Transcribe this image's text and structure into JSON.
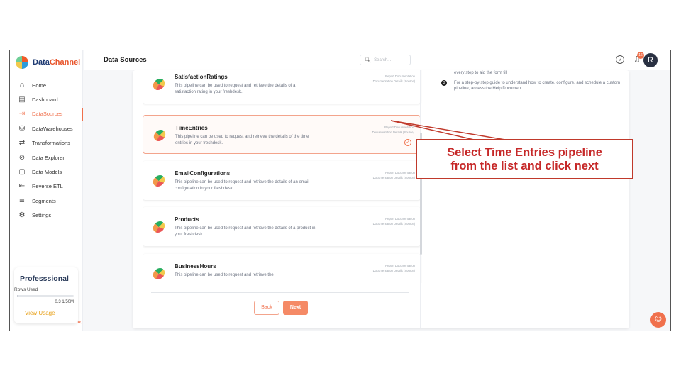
{
  "app": {
    "brand_first": "Data",
    "brand_second": "Channel",
    "page_title": "Data Sources"
  },
  "sidebar": {
    "items": [
      {
        "label": "Home",
        "icon": "home-icon",
        "glyph": "⌂"
      },
      {
        "label": "Dashboard",
        "icon": "dashboard-icon",
        "glyph": "▤"
      },
      {
        "label": "DataSources",
        "icon": "datasources-icon",
        "glyph": "⇥",
        "active": true
      },
      {
        "label": "DataWarehouses",
        "icon": "database-icon",
        "glyph": "⛁"
      },
      {
        "label": "Transformations",
        "icon": "transform-icon",
        "glyph": "⇄"
      },
      {
        "label": "Data Explorer",
        "icon": "explorer-icon",
        "glyph": "⊘"
      },
      {
        "label": "Data Models",
        "icon": "models-icon",
        "glyph": "▢"
      },
      {
        "label": "Reverse ETL",
        "icon": "reverse-etl-icon",
        "glyph": "⇤"
      },
      {
        "label": "Segments",
        "icon": "segments-icon",
        "glyph": "≡"
      },
      {
        "label": "Settings",
        "icon": "settings-icon",
        "glyph": "⚙"
      }
    ],
    "plan": {
      "title": "Professsional",
      "rows_label": "Rows Used",
      "usage": "0.3 1/50M",
      "usage_fraction": 0.01,
      "link": "View Usage"
    },
    "collapse_glyph": "«"
  },
  "header": {
    "search_placeholder": "Search...",
    "help_glyph": "?",
    "notification_count": "16",
    "avatar_initial": "R"
  },
  "pipelines": [
    {
      "title": "SatisfactionRatings",
      "desc": "This pipeline can be used to request and retrieve the details of a satisfaction rating in your freshdesk.",
      "link1": "Report Documentation",
      "link2": "Documentation Details (Source)",
      "selected": false
    },
    {
      "title": "TimeEntries",
      "desc": "This pipeline can be used to request and retrieve the details of the time entries in your freshdesk.",
      "link1": "Report Documentation",
      "link2": "Documentation Details (Source)",
      "selected": true
    },
    {
      "title": "EmailConfigurations",
      "desc": "This pipeline can be used to request and retrieve the details of an email configuration in your freshdesk.",
      "link1": "Report Documentation",
      "link2": "Documentation Details (Source)",
      "selected": false
    },
    {
      "title": "Products",
      "desc": "This pipeline can be used to request and retrieve the details of a product in your freshdesk.",
      "link1": "Report Documentation",
      "link2": "Documentation Details (Source)",
      "selected": false
    },
    {
      "title": "BusinessHours",
      "desc": "This pipeline can be used to request and retrieve the",
      "link1": "Report Documentation",
      "link2": "Documentation Details (Source)",
      "selected": false
    }
  ],
  "buttons": {
    "back": "Back",
    "next": "Next"
  },
  "help_panel": {
    "line1": "every step to aid the form fill",
    "step_number": "3",
    "step_text": "For a step-by-step guide to understand how to create, configure, and schedule a custom pipeline, access the Help Document."
  },
  "annotation": {
    "line1": "Select Time Entries pipeline",
    "line2": "from the list and click next",
    "color": "#c62828"
  },
  "colors": {
    "accent": "#f0704c",
    "brand_blue": "#1f3b73"
  }
}
